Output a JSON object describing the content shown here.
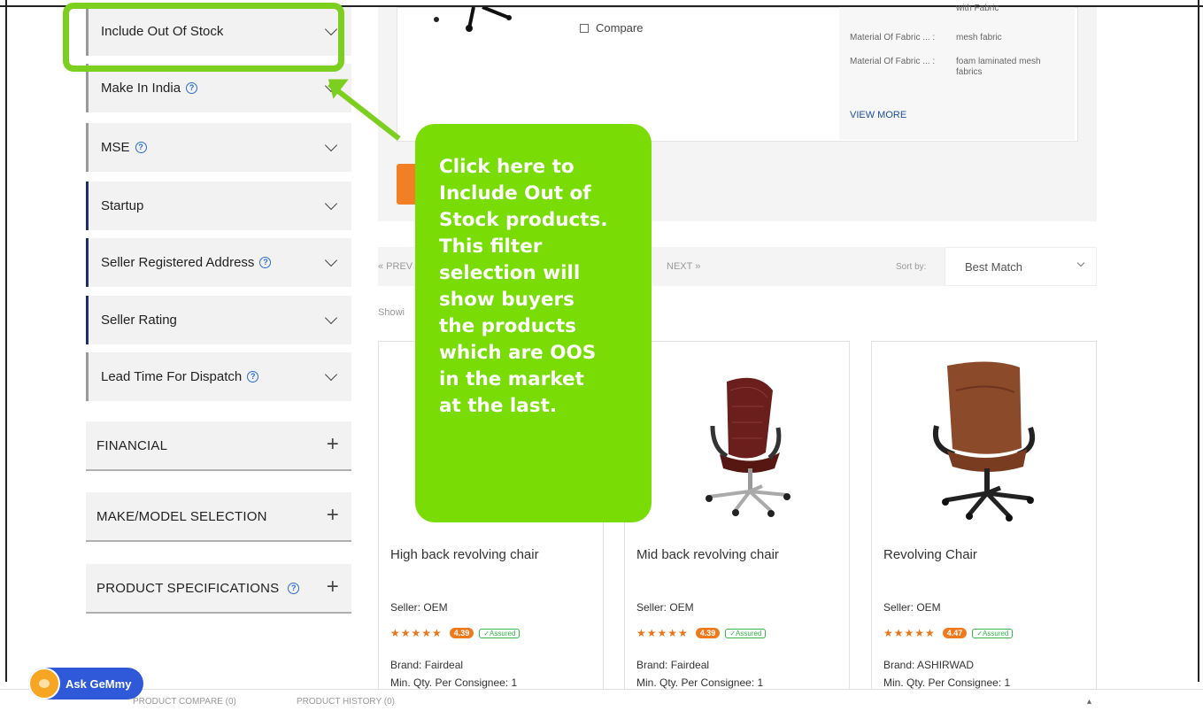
{
  "filters": [
    {
      "label": "Include Out Of Stock",
      "help": false
    },
    {
      "label": "Make In India",
      "help": true
    },
    {
      "label": "MSE",
      "help": true
    },
    {
      "label": "Startup",
      "help": false
    },
    {
      "label": "Seller Registered Address",
      "help": true
    },
    {
      "label": "Seller Rating",
      "help": false
    },
    {
      "label": "Lead Time For Dispatch",
      "help": true
    }
  ],
  "sections": [
    {
      "label": "FINANCIAL"
    },
    {
      "label": "MAKE/MODEL SELECTION"
    },
    {
      "label": "PRODUCT SPECIFICATIONS",
      "help": true
    }
  ],
  "top_product": {
    "compare_label": "Compare",
    "specs": [
      {
        "key": "",
        "value": "with Fabric"
      },
      {
        "key": "Material Of Fabric ... :",
        "value": "mesh fabric"
      },
      {
        "key": "Material Of Fabric ... :",
        "value": "foam laminated mesh fabrics"
      }
    ],
    "view_more": "VIEW MORE"
  },
  "pagination": {
    "prev": "« PREV",
    "next": "NEXT »",
    "sort_label": "Sort by:",
    "sort_value": "Best Match",
    "showing": "Showi"
  },
  "products": [
    {
      "name": "High back revolving chair",
      "seller": "Seller: OEM",
      "stars": "★★★★★",
      "rating": "4.39",
      "verified": "✓Assured",
      "brand": "Brand: Fairdeal",
      "min_qty": "Min. Qty. Per Consignee: 1"
    },
    {
      "name": "Mid back revolving chair",
      "seller": "Seller: OEM",
      "stars": "★★★★★",
      "rating": "4.39",
      "verified": "✓Assured",
      "brand": "Brand: Fairdeal",
      "min_qty": "Min. Qty. Per Consignee: 1"
    },
    {
      "name": "Revolving Chair",
      "seller": "Seller: OEM",
      "stars": "★★★★★",
      "rating": "4.47",
      "verified": "✓Assured",
      "brand": "Brand: ASHIRWAD",
      "min_qty": "Min. Qty. Per Consignee: 1"
    }
  ],
  "callout": {
    "lines": [
      "Click here to",
      "Include Out of",
      "Stock products.",
      "This filter",
      "selection will",
      "show buyers",
      "the products",
      "which are OOS",
      "in the market",
      "at the last."
    ]
  },
  "bottom_bar": {
    "product_compare": "PRODUCT COMPARE",
    "compare_count": "0",
    "product_history": "PRODUCT HISTORY",
    "history_count": "0"
  },
  "assistant": {
    "label": "Ask GeMmy"
  },
  "colors": {
    "callout": "#79dc05",
    "highlight": "#7ccf1f",
    "accent_orange": "#f07f25",
    "filter_active_border": "#1c2f6e"
  }
}
